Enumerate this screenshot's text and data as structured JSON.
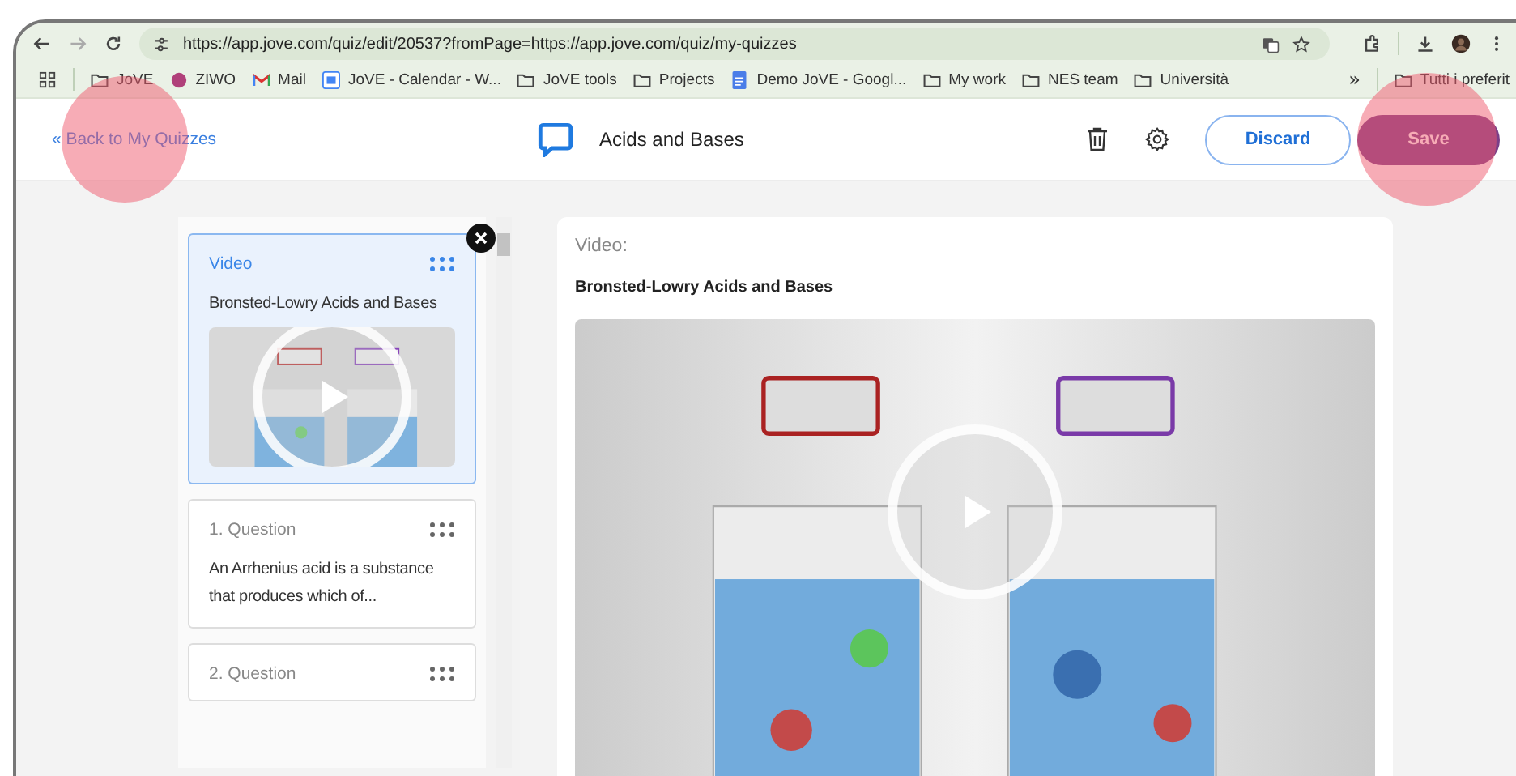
{
  "browser": {
    "url": "https://app.jove.com/quiz/edit/20537?fromPage=https://app.jove.com/quiz/my-quizzes",
    "bookmarks": [
      {
        "label": "JoVE",
        "kind": "folder"
      },
      {
        "label": "ZIWO",
        "kind": "dot"
      },
      {
        "label": "Mail",
        "kind": "mail"
      },
      {
        "label": "JoVE - Calendar - W...",
        "kind": "calendar"
      },
      {
        "label": "JoVE tools",
        "kind": "folder"
      },
      {
        "label": "Projects",
        "kind": "folder"
      },
      {
        "label": "Demo JoVE - Googl...",
        "kind": "doc"
      },
      {
        "label": "My work",
        "kind": "folder"
      },
      {
        "label": "NES team",
        "kind": "folder"
      },
      {
        "label": "Università",
        "kind": "folder"
      }
    ],
    "overflow": "»",
    "other_bookmarks": "Tutti i preferit"
  },
  "header": {
    "back": "« Back to My Quizzes",
    "title": "Acids and Bases",
    "discard": "Discard",
    "save": "Save"
  },
  "items": [
    {
      "kind": "video",
      "type_label": "Video",
      "title": "Bronsted-Lowry Acids and Bases",
      "selected": true
    },
    {
      "kind": "question",
      "type_label": "1. Question",
      "title": "An Arrhenius acid is a substance that produces which of...",
      "selected": false
    },
    {
      "kind": "question",
      "type_label": "2. Question",
      "selected": false
    }
  ],
  "detail": {
    "label": "Video:",
    "title": "Bronsted-Lowry Acids and Bases"
  }
}
